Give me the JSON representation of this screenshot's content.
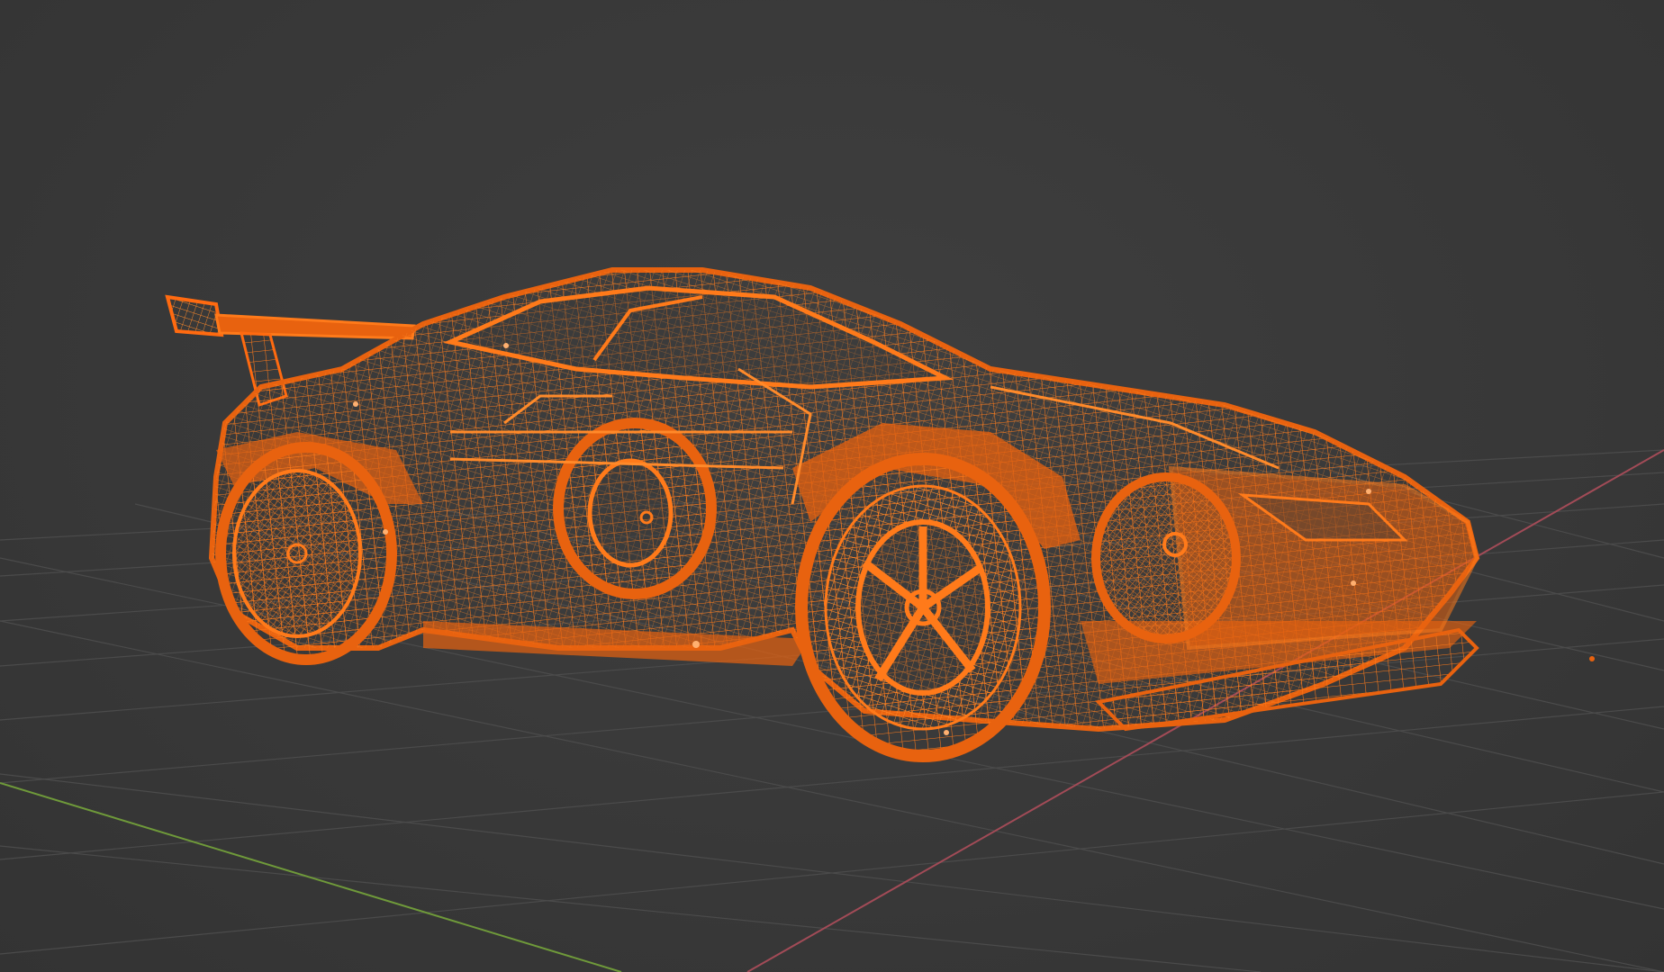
{
  "viewport": {
    "mode": "wireframe",
    "selected_object": "car",
    "object_count_selected": 1
  },
  "colors": {
    "background": "#3a3a3a",
    "grid": "#4a4a4a",
    "x_axis": "#a24b57",
    "y_axis": "#6f9a3a",
    "selection": "#e8620f"
  },
  "icons": {
    "origin_marker": "object-origin-dot"
  }
}
